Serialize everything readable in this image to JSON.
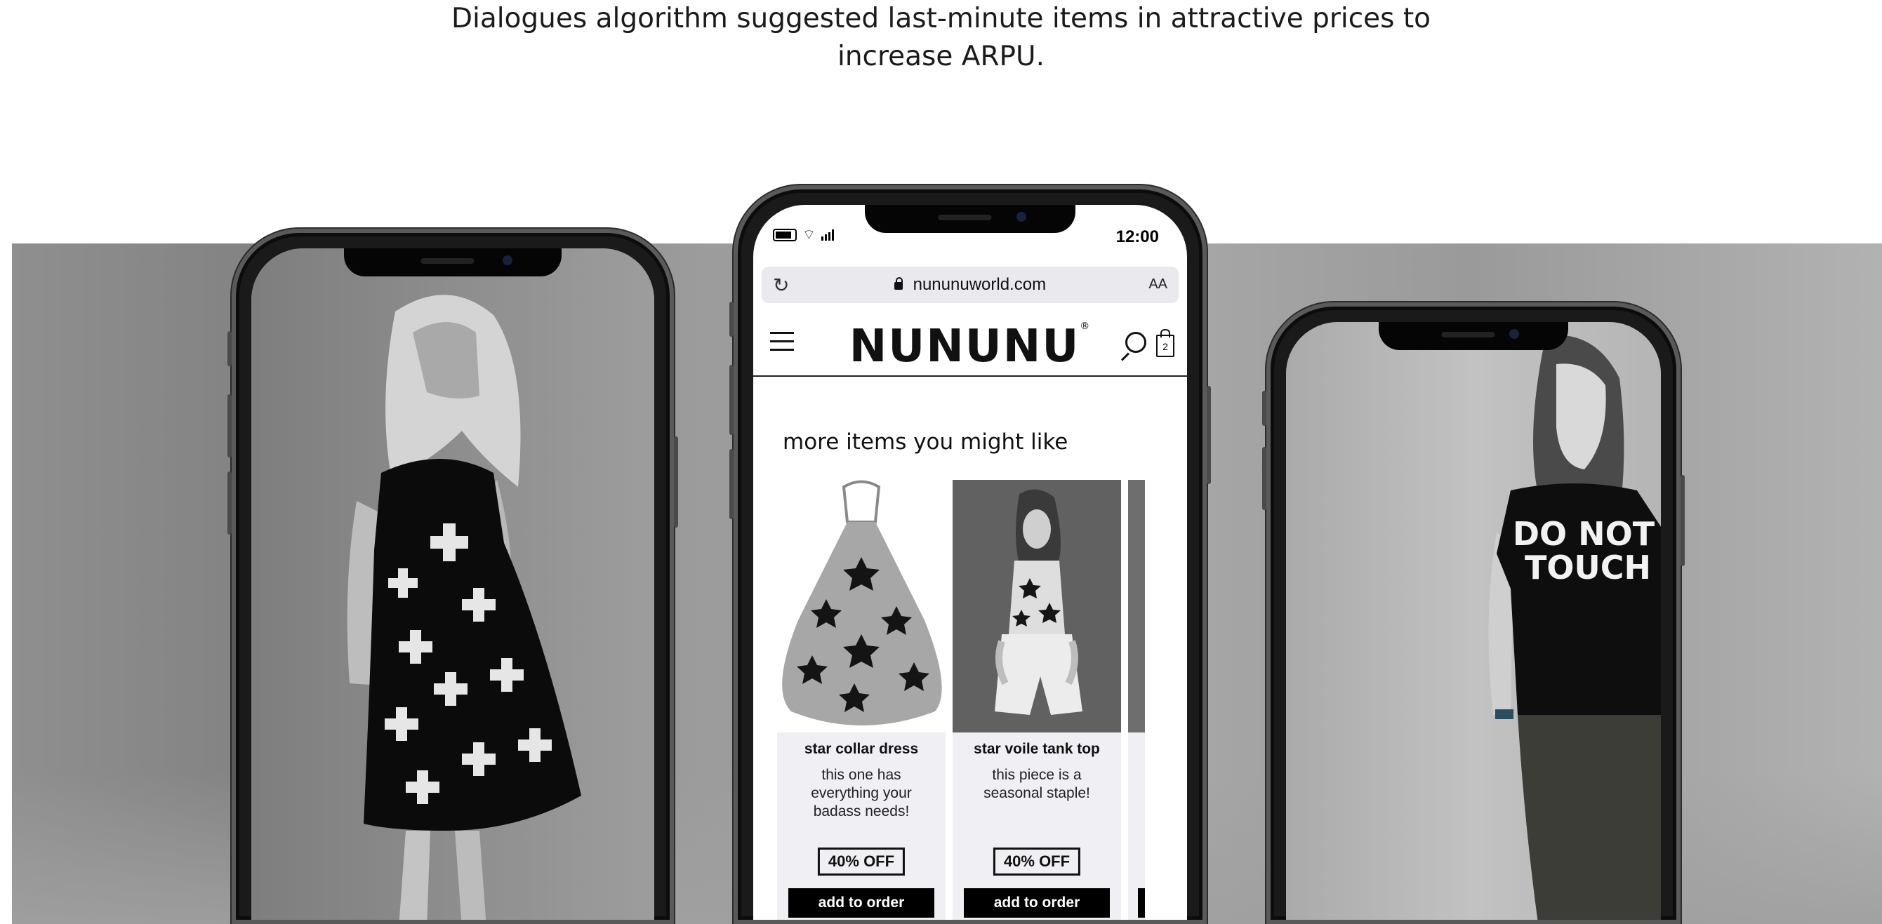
{
  "caption": {
    "line1": "Dialogues algorithm suggested last-minute items in attractive prices to",
    "line2": "increase ARPU."
  },
  "left_phone": {
    "scene": "girl in black cross-print dress"
  },
  "right_phone": {
    "scene": "boy in black tee",
    "tee_text_line1": "DO NOT",
    "tee_text_line2": "TOUCH"
  },
  "center_phone": {
    "status_bar": {
      "time": "12:00"
    },
    "browser": {
      "url": "nununuworld.com",
      "text_size": "AA"
    },
    "site": {
      "logo": "NUNUNU",
      "logo_mark": "®",
      "bag_count": "2"
    },
    "recommendations": {
      "title": "more items you might like",
      "items": [
        {
          "name": "star collar dress",
          "description": "this one has everything your badass needs!",
          "badge": "40% OFF",
          "cta": "add to order"
        },
        {
          "name": "star voile tank top",
          "description": "this piece is a seasonal staple!",
          "badge": "40% OFF",
          "cta": "add to order"
        }
      ]
    }
  }
}
